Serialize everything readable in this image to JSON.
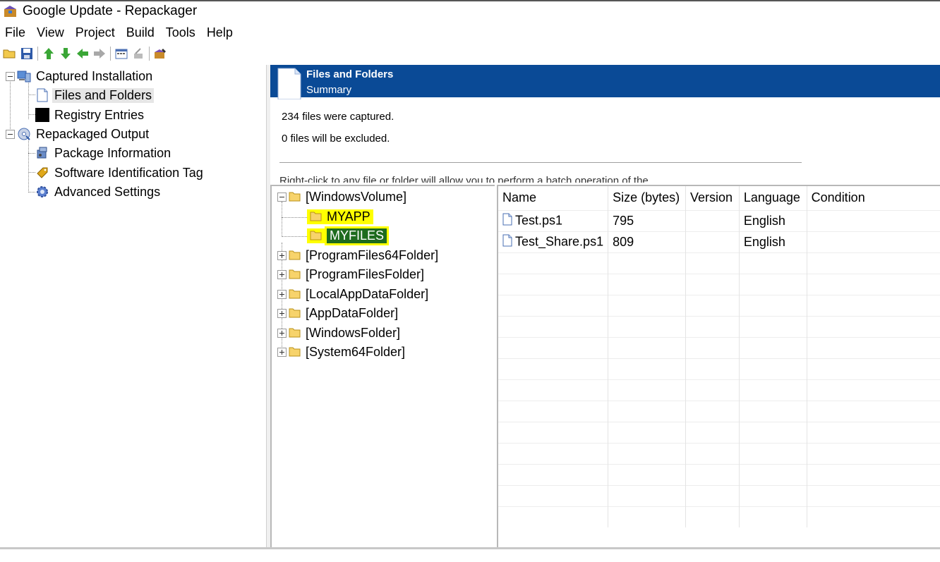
{
  "window": {
    "title": "Google Update - Repackager"
  },
  "menu": [
    "File",
    "View",
    "Project",
    "Build",
    "Tools",
    "Help"
  ],
  "toolbar": [
    "open-icon",
    "save-icon",
    "move-up-icon",
    "move-down-icon",
    "back-icon",
    "forward-icon",
    "properties-icon",
    "delete-icon",
    "build-icon"
  ],
  "nav": {
    "captured_installation": "Captured Installation",
    "files_and_folders": "Files and Folders",
    "registry_entries": "Registry Entries",
    "repackaged_output": "Repackaged Output",
    "package_information": "Package Information",
    "software_identification_tag": "Software Identification Tag",
    "advanced_settings": "Advanced Settings"
  },
  "header": {
    "title": "Files and Folders",
    "subtitle": "Summary"
  },
  "summary": {
    "captured": "234 files were captured.",
    "excluded": "0 files will be excluded.",
    "cut_off_text": "Right-click to any file or folder will allow you to perform a batch operation of the ..."
  },
  "folder_tree": {
    "root": "[WindowsVolume]",
    "children": [
      "MYAPP",
      "MYFILES"
    ],
    "others": [
      "[ProgramFiles64Folder]",
      "[ProgramFilesFolder]",
      "[LocalAppDataFolder]",
      "[AppDataFolder]",
      "[WindowsFolder]",
      "[System64Folder]"
    ]
  },
  "file_list": {
    "columns": [
      "Name",
      "Size (bytes)",
      "Version",
      "Language",
      "Condition"
    ],
    "rows": [
      {
        "name": "Test.ps1",
        "size": "795",
        "version": "",
        "language": "English",
        "condition": ""
      },
      {
        "name": "Test_Share.ps1",
        "size": "809",
        "version": "",
        "language": "English",
        "condition": ""
      }
    ]
  }
}
